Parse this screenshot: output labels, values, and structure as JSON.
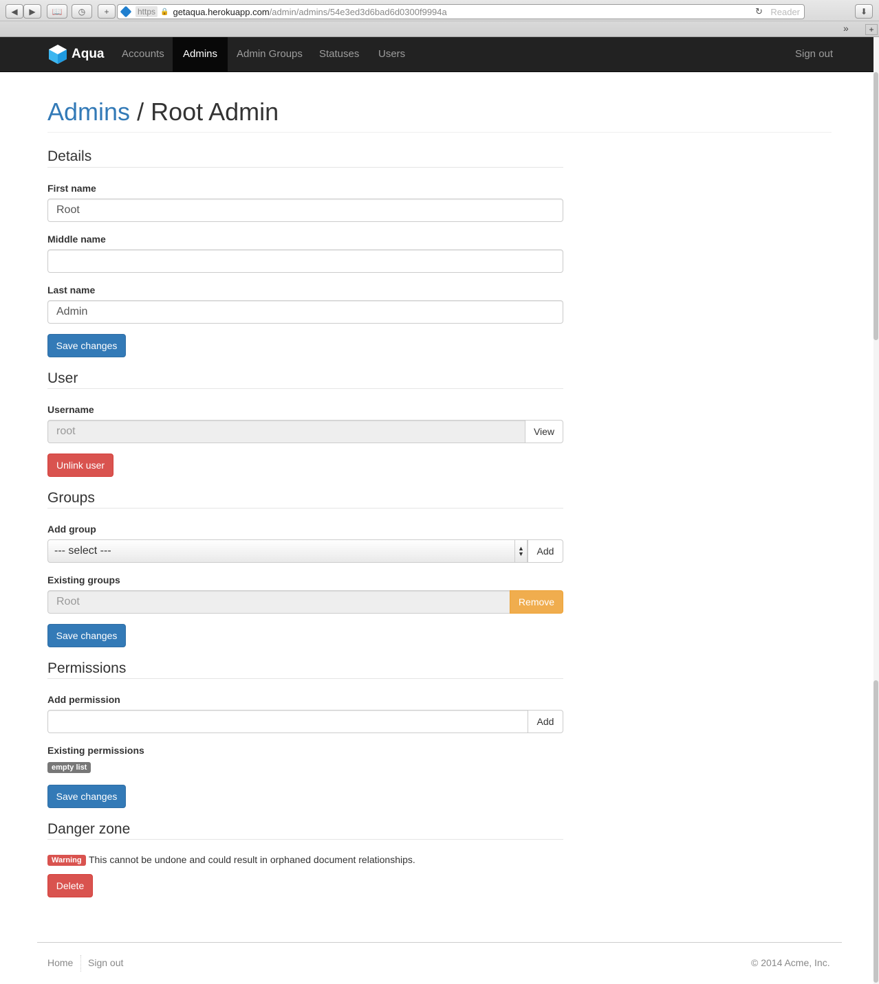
{
  "browser": {
    "https": "https",
    "host": "getaqua.herokuapp.com",
    "path": "/admin/admins/54e3ed3d6bad6d0300f9994a",
    "reader": "Reader"
  },
  "navbar": {
    "brand": "Aqua",
    "items": [
      {
        "label": "Accounts"
      },
      {
        "label": "Admins"
      },
      {
        "label": "Admin Groups"
      },
      {
        "label": "Statuses"
      },
      {
        "label": "Users"
      }
    ],
    "active": "Admins",
    "sign_out": "Sign out"
  },
  "page": {
    "breadcrumb_link": "Admins",
    "separator": "/",
    "title": "Root Admin"
  },
  "details": {
    "heading": "Details",
    "first_name_label": "First name",
    "first_name_value": "Root",
    "middle_name_label": "Middle name",
    "middle_name_value": "",
    "last_name_label": "Last name",
    "last_name_value": "Admin",
    "save_label": "Save changes"
  },
  "user": {
    "heading": "User",
    "username_label": "Username",
    "username_value": "root",
    "view_label": "View",
    "unlink_label": "Unlink user"
  },
  "groups": {
    "heading": "Groups",
    "add_group_label": "Add group",
    "select_value": "--- select ---",
    "add_label": "Add",
    "existing_label": "Existing groups",
    "existing_value": "Root",
    "remove_label": "Remove",
    "save_label": "Save changes"
  },
  "permissions": {
    "heading": "Permissions",
    "add_label_text": "Add permission",
    "add_value": "",
    "add_button": "Add",
    "existing_label": "Existing permissions",
    "empty_badge": "empty list",
    "save_label": "Save changes"
  },
  "danger": {
    "heading": "Danger zone",
    "warning_badge": "Warning",
    "warning_text": "This cannot be undone and could result in orphaned document relationships.",
    "delete_label": "Delete"
  },
  "footer": {
    "home": "Home",
    "sign_out": "Sign out",
    "copyright": "© 2014 Acme, Inc."
  },
  "colors": {
    "primary": "#337ab7",
    "danger": "#d9534f",
    "warning": "#f0ad4e",
    "navbar": "#222222"
  }
}
